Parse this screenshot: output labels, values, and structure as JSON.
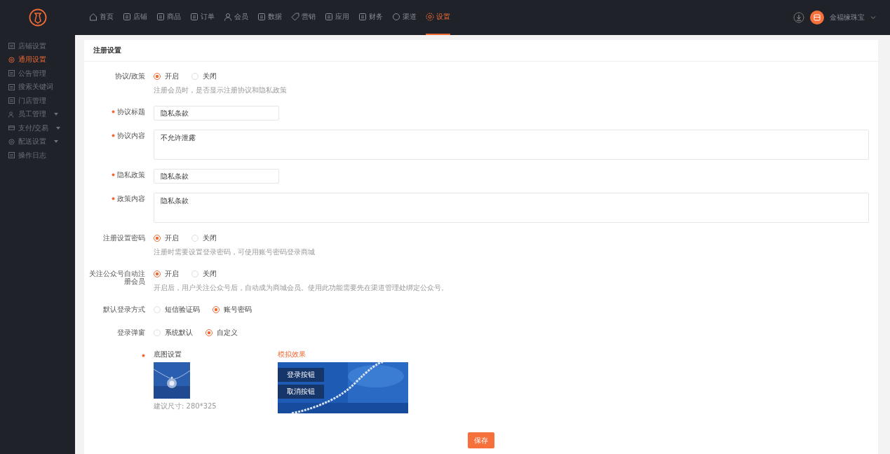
{
  "topbar": {
    "nav": [
      {
        "label": "首页",
        "selected": false
      },
      {
        "label": "店铺",
        "selected": false
      },
      {
        "label": "商品",
        "selected": false
      },
      {
        "label": "订单",
        "selected": false
      },
      {
        "label": "会员",
        "selected": false
      },
      {
        "label": "数据",
        "selected": false
      },
      {
        "label": "营销",
        "selected": false
      },
      {
        "label": "应用",
        "selected": false
      },
      {
        "label": "财务",
        "selected": false
      },
      {
        "label": "渠道",
        "selected": false
      },
      {
        "label": "设置",
        "selected": true
      }
    ],
    "user": "金福缘珠宝"
  },
  "sidebar": {
    "items": [
      {
        "label": "店铺设置",
        "selected": false,
        "expandable": false
      },
      {
        "label": "通用设置",
        "selected": true,
        "expandable": false
      },
      {
        "label": "公告管理",
        "selected": false,
        "expandable": false
      },
      {
        "label": "搜索关键词",
        "selected": false,
        "expandable": false
      },
      {
        "label": "门店管理",
        "selected": false,
        "expandable": false
      },
      {
        "label": "员工管理",
        "selected": false,
        "expandable": true
      },
      {
        "label": "支付/交易",
        "selected": false,
        "expandable": true
      },
      {
        "label": "配送设置",
        "selected": false,
        "expandable": true
      },
      {
        "label": "操作日志",
        "selected": false,
        "expandable": false
      }
    ]
  },
  "card": {
    "title": "注册设置",
    "fields": [
      {
        "kind": "radio",
        "label": "协议/政策",
        "required": false,
        "options": [
          {
            "label": "开启",
            "selected": true
          },
          {
            "label": "关闭",
            "selected": false
          }
        ],
        "hint": "注册会员时，是否显示注册协议和隐私政策"
      },
      {
        "kind": "input",
        "label": "协议标题",
        "required": true,
        "value": "隐私条款"
      },
      {
        "kind": "textarea",
        "label": "协议内容",
        "required": true,
        "value": "不允许泄露"
      },
      {
        "kind": "input",
        "label": "隐私政策",
        "required": true,
        "value": "隐私条款"
      },
      {
        "kind": "textarea",
        "label": "政策内容",
        "required": true,
        "value": "隐私条款"
      },
      {
        "kind": "radio",
        "label": "注册设置密码",
        "required": false,
        "options": [
          {
            "label": "开启",
            "selected": true
          },
          {
            "label": "关闭",
            "selected": false
          }
        ],
        "hint": "注册时需要设置登录密码，可使用账号密码登录商城"
      },
      {
        "kind": "radio",
        "label": "关注公众号自动注册会员",
        "required": false,
        "options": [
          {
            "label": "开启",
            "selected": true
          },
          {
            "label": "关闭",
            "selected": false
          }
        ],
        "hint": "开启后，用户关注公众号后，自动成为商城会员。使用此功能需要先在渠道管理处绑定公众号。"
      },
      {
        "kind": "radio",
        "label": "默认登录方式",
        "required": false,
        "options": [
          {
            "label": "短信验证码",
            "selected": false
          },
          {
            "label": "账号密码",
            "selected": true
          }
        ]
      },
      {
        "kind": "radio",
        "label": "登录弹窗",
        "required": false,
        "options": [
          {
            "label": "系统默认",
            "selected": false
          },
          {
            "label": "自定义",
            "selected": true
          }
        ]
      }
    ],
    "background": {
      "required": true,
      "label": "底图设置",
      "size_hint": "建议尺寸: 280*325",
      "preview_label": "模拟效果",
      "preview_buttons": [
        "登录按钮",
        "取消按钮"
      ]
    },
    "save": "保存"
  }
}
